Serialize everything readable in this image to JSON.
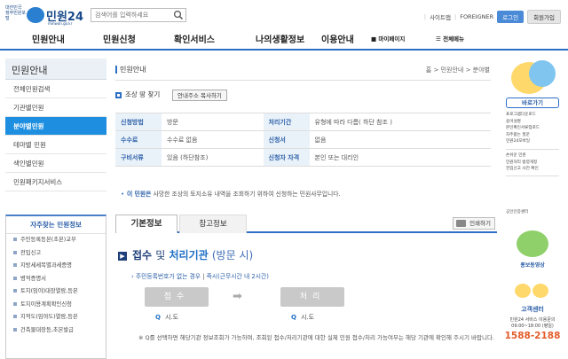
{
  "header": {
    "logo_emblem": "대한민국 정부민원포털",
    "logo_name": "민원24",
    "logo_sub": "minwon.go.kr",
    "search_placeholder": "검색어를 입력하세요",
    "links": [
      "사이트맵",
      "FOREIGNER"
    ],
    "login": "로그인",
    "signup": "회원가입"
  },
  "nav": {
    "items": [
      "민원안내",
      "민원신청",
      "확인서비스",
      "나의생활정보",
      "이용안내"
    ],
    "mypage": "마이페이지",
    "allmenu": "전체메뉴"
  },
  "sidebar": {
    "title": "민원안내",
    "items": [
      {
        "label": "전체민원검색",
        "active": false
      },
      {
        "label": "기관별민원",
        "active": false
      },
      {
        "label": "분야별민원",
        "active": true
      },
      {
        "label": "테마별 민원",
        "active": false
      },
      {
        "label": "색인별민원",
        "active": false
      },
      {
        "label": "민원패키지서비스",
        "active": false
      }
    ],
    "favorites": {
      "title": "자주찾는 민원정보",
      "items": [
        "주민등록등본(초본)교부",
        "전입신고",
        "지방세세목별과세증명",
        "병적증명서",
        "토지(임야)대장열람,등본",
        "토지이용계획확인신청",
        "지적도(임야도)열람,등본",
        "건축물대장등,초본발급"
      ]
    }
  },
  "page": {
    "title": "민원안내",
    "breadcrumb": [
      "홈",
      "민원안내",
      "분야별"
    ],
    "find_position": "조상 땅 찾기",
    "copy_address": "안내주소 복사하기",
    "info": [
      {
        "label": "신청방법",
        "value": "방문",
        "label2": "처리기간",
        "value2": "유형에 따라 다름( 하단 참조 )"
      },
      {
        "label": "수수료",
        "value": "수수료 없음",
        "label2": "신청서",
        "value2": "없음"
      },
      {
        "label": "구비서류",
        "value": "있음 (하단참조)",
        "label2": "신청자 자격",
        "value2": "본인 또는 대리인"
      }
    ],
    "description_lead": "이 민원은",
    "description": "사망한 조상의 토지소유 내역을 조회하기 위하여 신청하는 민원사무입니다.",
    "tabs": [
      "기본정보",
      "참고정보"
    ],
    "print": "인쇄하기",
    "section_title": {
      "a": "접수",
      "b": "및",
      "c": "처리기관",
      "d": "(방문 시)"
    },
    "sub_note": {
      "lead": "주민등록번호가 없는 경우",
      "sep": "|",
      "rest": "즉시(근무시간 내 2시간)"
    },
    "flow": {
      "left": "접수",
      "right": "처리",
      "left_org": "시.도",
      "right_org": "시.도"
    },
    "foot_note": "※ Q를 선택하면 해당기관 정보조회가 가능하며, 조회된 접수/처리기관에 대한 실제 민원 접수/처리 가능여부는 해당 기관에 확인해 주시기 바랍니다."
  },
  "rail": {
    "quick": "바로가기",
    "quick_items": [
      "프로그램다운로드",
      "용어설명",
      "본인확인서류업로드",
      "자주묻는 질문",
      "민원24모바일"
    ],
    "links": [
      "손쉬운 민원",
      "민원처리 법령개정",
      "전입신고 사전 확인",
      "공인인증센터"
    ],
    "promo": "홍보동영상",
    "center": "고객센터",
    "center_line1": "민원24 서비스 이용문의",
    "center_hours": "09:00~18:00 (평일)",
    "phone": "1588-2188"
  }
}
